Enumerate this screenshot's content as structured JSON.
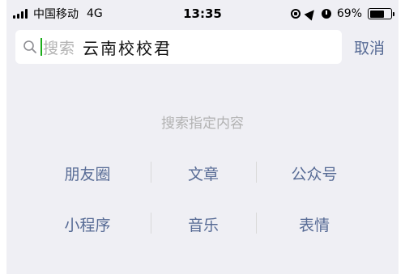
{
  "status_bar": {
    "carrier": "中国移动",
    "network": "4G",
    "time": "13:35",
    "battery_percent": "69%",
    "battery_level": 0.69,
    "icons": [
      "signal-icon",
      "rotation-lock-icon",
      "location-icon",
      "alarm-icon",
      "battery-icon"
    ]
  },
  "search": {
    "placeholder": "搜索",
    "query": "云南校校君",
    "cancel_label": "取消"
  },
  "content": {
    "hint": "搜索指定内容",
    "categories": [
      {
        "label": "朋友圈"
      },
      {
        "label": "文章"
      },
      {
        "label": "公众号"
      },
      {
        "label": "小程序"
      },
      {
        "label": "音乐"
      },
      {
        "label": "表情"
      }
    ]
  },
  "colors": {
    "background": "#efeff4",
    "link": "#576b95",
    "hint": "#b2b2b2",
    "caret": "#1aad19"
  }
}
